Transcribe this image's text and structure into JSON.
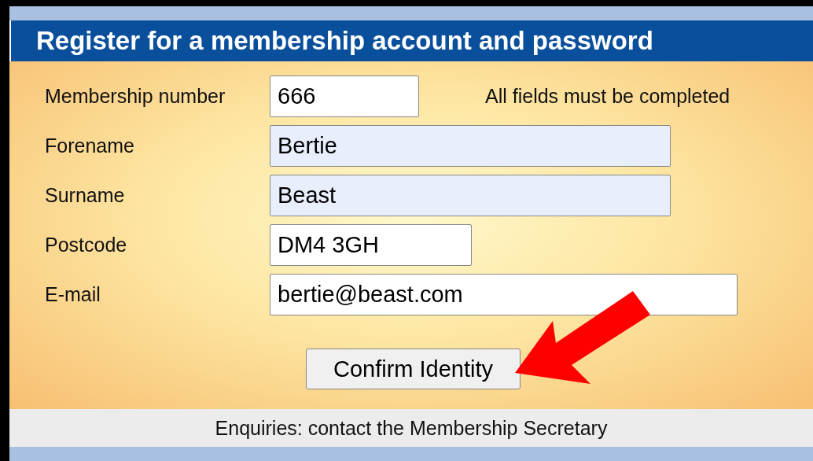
{
  "title": "Register for a membership account and password",
  "note": "All fields must be completed",
  "fields": [
    {
      "label": "Membership number",
      "value": "666",
      "highlighted": false
    },
    {
      "label": "Forename",
      "value": "Bertie",
      "highlighted": true
    },
    {
      "label": "Surname",
      "value": "Beast",
      "highlighted": true
    },
    {
      "label": "Postcode",
      "value": "DM4 3GH",
      "highlighted": false
    },
    {
      "label": "E-mail",
      "value": "bertie@beast.com",
      "highlighted": false
    }
  ],
  "button": "Confirm Identity",
  "footer": "Enquiries: contact the Membership Secretary"
}
